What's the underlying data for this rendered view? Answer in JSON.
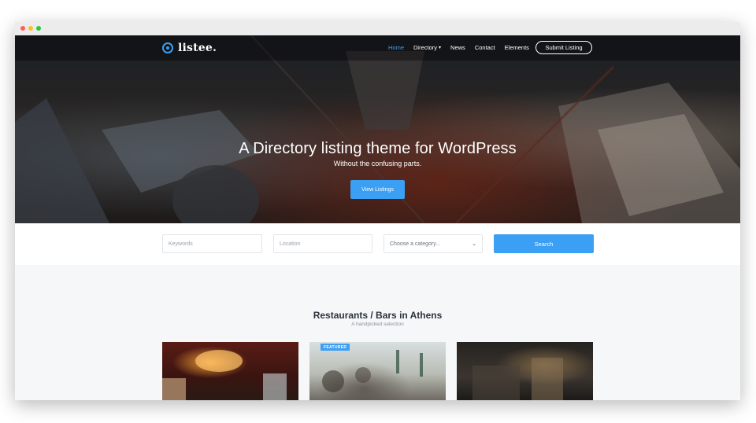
{
  "nav": {
    "logo_text": "listee.",
    "items": [
      {
        "label": "Home",
        "active": true
      },
      {
        "label": "Directory",
        "has_dropdown": true
      },
      {
        "label": "News"
      },
      {
        "label": "Contact"
      },
      {
        "label": "Elements"
      }
    ],
    "submit_label": "Submit Listing"
  },
  "hero": {
    "title": "A Directory listing theme for WordPress",
    "subtitle": "Without the confusing parts.",
    "button_label": "View Listings"
  },
  "search": {
    "keywords_placeholder": "Keywords",
    "location_placeholder": "Location",
    "category_selected": "Choose a category...",
    "button_label": "Search"
  },
  "section": {
    "title": "Restaurants / Bars in Athens",
    "subtitle": "A handpicked selection"
  },
  "cards": [
    {
      "badge": ""
    },
    {
      "badge": "FEATURED"
    },
    {
      "badge": ""
    }
  ],
  "colors": {
    "accent": "#3b9ff3",
    "page_bg": "#f5f7f9",
    "heading": "#2b323a"
  },
  "icons": {
    "logo": "logo-ring-icon",
    "dropdown": "chevron-down-icon"
  }
}
